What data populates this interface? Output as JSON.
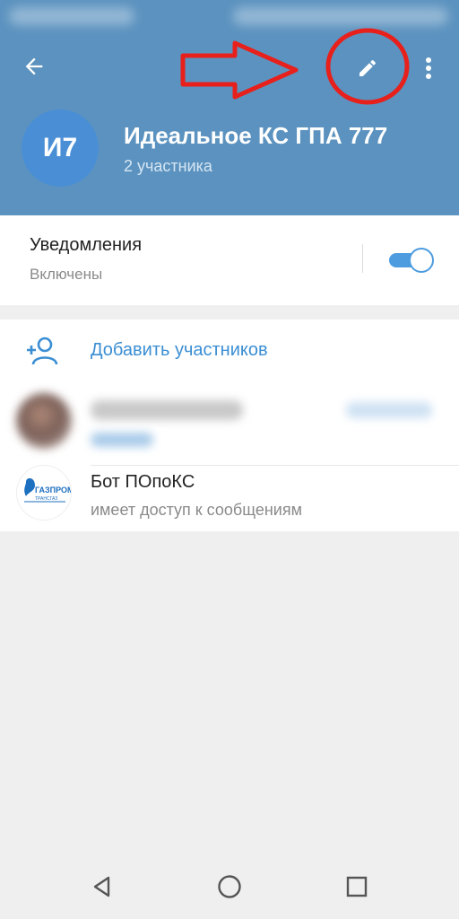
{
  "header": {
    "title": "Идеальное КС ГПА 777",
    "subtitle": "2 участника",
    "avatar_initials": "И7",
    "background": "#5b92bf"
  },
  "icons": {
    "back": "arrow-left-icon",
    "edit": "pencil-icon",
    "more": "more-vertical-icon",
    "add_member": "person-add-icon"
  },
  "notifications": {
    "label": "Уведомления",
    "status": "Включены",
    "enabled": true
  },
  "members": {
    "add_label": "Добавить участников",
    "list": [
      {
        "name": "",
        "status": "",
        "role": "",
        "blurred": true
      },
      {
        "name": "Бот ПОпоКС",
        "status": "имеет доступ к сообщениям",
        "blurred": false
      }
    ]
  },
  "bot_logo": {
    "text_top": "ГАЗПРОМ",
    "text_bottom": "ТРАНСГАЗ",
    "accent": "#1d6fbf"
  },
  "accent": "#4c9cdf",
  "annotation_color": "#e8201c"
}
